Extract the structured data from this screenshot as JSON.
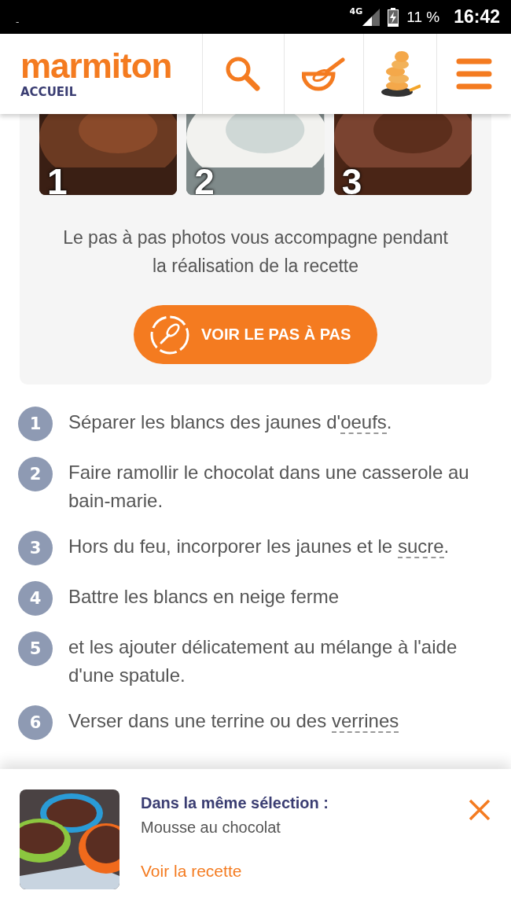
{
  "status_bar": {
    "left_mark": "-",
    "network": "4G",
    "battery": "11 %",
    "time": "16:42"
  },
  "header": {
    "logo": "marmiton",
    "logo_caption": "ACCUEIL"
  },
  "step_photos": {
    "photos": [
      {
        "number": "1"
      },
      {
        "number": "2"
      },
      {
        "number": "3"
      }
    ],
    "text": "Le pas à pas photos vous accompagne pendant la réalisation de la recette",
    "button": "VOIR LE PAS À PAS"
  },
  "steps": [
    {
      "number": "1",
      "parts": [
        {
          "text": "Séparer les blancs des jaunes d'",
          "kind": "plain"
        },
        {
          "text": "oeufs",
          "kind": "term"
        },
        {
          "text": ".",
          "kind": "plain"
        }
      ]
    },
    {
      "number": "2",
      "parts": [
        {
          "text": "Faire ramollir le chocolat dans une casserole au bain-marie.",
          "kind": "plain"
        }
      ]
    },
    {
      "number": "3",
      "parts": [
        {
          "text": "Hors du feu, incorporer les jaunes et le ",
          "kind": "plain"
        },
        {
          "text": "sucre",
          "kind": "term"
        },
        {
          "text": ".",
          "kind": "plain"
        }
      ]
    },
    {
      "number": "4",
      "parts": [
        {
          "text": "Battre les blancs en neige ferme",
          "kind": "plain"
        }
      ]
    },
    {
      "number": "5",
      "parts": [
        {
          "text": "et les ajouter délicatement au mélange à l'aide d'une spatule.",
          "kind": "plain"
        }
      ]
    },
    {
      "number": "6",
      "parts": [
        {
          "text": "Verser dans une terrine ou des ",
          "kind": "plain"
        },
        {
          "text": "verrines",
          "kind": "term"
        }
      ]
    }
  ],
  "suggestion": {
    "heading": "Dans la même sélection :",
    "title": "Mousse au chocolat",
    "link": "Voir la recette"
  }
}
